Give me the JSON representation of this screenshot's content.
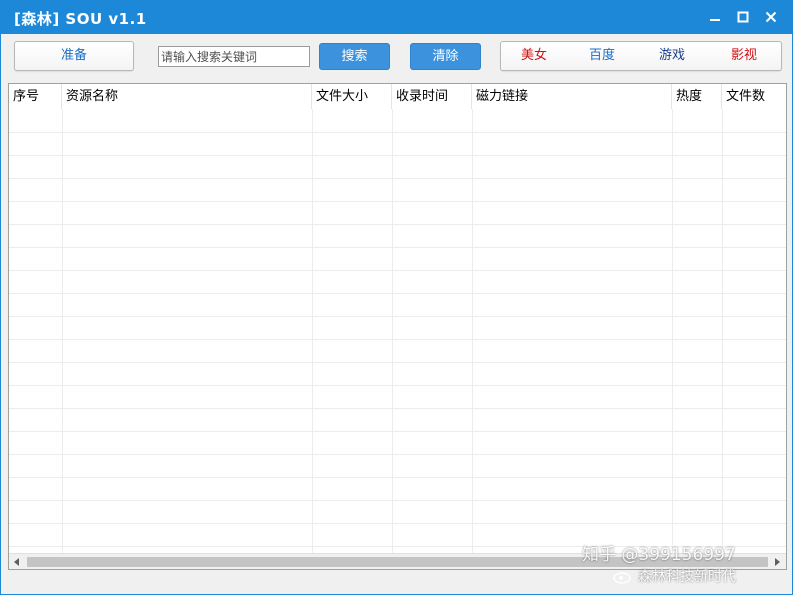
{
  "window": {
    "title": "[森林] SOU v1.1"
  },
  "toolbar": {
    "prepare_label": "准备",
    "search_placeholder": "请输入搜索关键词",
    "search_label": "搜索",
    "clear_label": "清除"
  },
  "categories": [
    {
      "label": "美女",
      "color": "#d21010"
    },
    {
      "label": "百度",
      "color": "#1a6fc7"
    },
    {
      "label": "游戏",
      "color": "#1a3e8c"
    },
    {
      "label": "影视",
      "color": "#d21010"
    }
  ],
  "table": {
    "columns": [
      "序号",
      "资源名称",
      "文件大小",
      "收录时间",
      "磁力链接",
      "热度",
      "文件数"
    ]
  },
  "watermark": {
    "line1": "知乎 @399156997",
    "line2": "森林科技新时代"
  },
  "colors": {
    "titlebar": "#1e88d8",
    "button_blue": "#3c92dc"
  },
  "icons": [
    "minimize-icon",
    "maximize-icon",
    "close-icon",
    "scroll-left-arrow-icon",
    "scroll-right-arrow-icon"
  ]
}
